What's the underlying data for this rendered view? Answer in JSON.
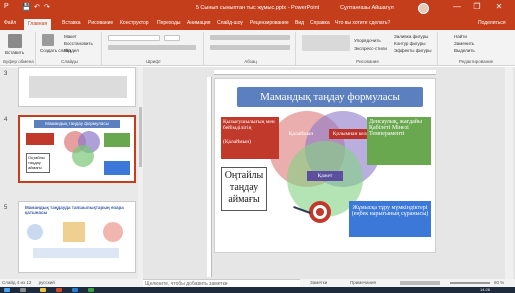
{
  "window": {
    "title": "5 Сынып сыныптан тыс жұмыс.pptx - PowerPoint",
    "user": "Сұлтанғазы Айшагүл",
    "minimize_glyph": "—",
    "restore_glyph": "❐",
    "close_glyph": "✕",
    "save_glyph": "💾",
    "undo_glyph": "↶",
    "redo_glyph": "↷"
  },
  "tabs": [
    {
      "label": "Файл"
    },
    {
      "label": "Главная"
    },
    {
      "label": "Вставка"
    },
    {
      "label": "Рисование"
    },
    {
      "label": "Конструктор"
    },
    {
      "label": "Переходы"
    },
    {
      "label": "Анимация"
    },
    {
      "label": "Слайд-шоу"
    },
    {
      "label": "Рецензирование"
    },
    {
      "label": "Вид"
    },
    {
      "label": "Справка"
    },
    {
      "label": "Что вы хотите сделать?"
    },
    {
      "label": "Поделиться"
    }
  ],
  "ribbon": {
    "clipboard": {
      "paste": "Вставить",
      "label": "Буфер обмена"
    },
    "slides": {
      "new_slide": "Создать слайд",
      "layout": "Макет",
      "reset": "Восстановить",
      "section": "Раздел",
      "label": "Слайды"
    },
    "font": {
      "label": "Шрифт"
    },
    "paragraph": {
      "label": "Абзац"
    },
    "drawing": {
      "arrange": "Упорядочить",
      "styles": "Экспресс-стили",
      "fill": "Заливка фигуры",
      "outline": "Контур фигуры",
      "effects": "Эффекты фигуры",
      "label": "Рисование"
    },
    "editing": {
      "find": "Найти",
      "replace": "Заменить",
      "select": "Выделить",
      "label": "Редактирование"
    }
  },
  "thumbnails": [
    {
      "num": "3"
    },
    {
      "num": "4",
      "title": "Мамандық таңдау формуласы",
      "sub": "Оңтайлы таңдау аймағы"
    },
    {
      "num": "5",
      "title": "Мамандық таңдауда тапшылықтарың өзара қатынасы"
    }
  ],
  "slide": {
    "title": "Мамандық таңдау формуласы",
    "box_left_top": "Қызығушылығың мен бейімділігің",
    "box_left_sub": "(Қалаймын)",
    "label_want": "Қалаймын",
    "label_can": "Қолымнан келеді",
    "box_right": "Денсаулық, жағдайы Қабілеті Мінезі Темпераменті",
    "label_need": "Қажет",
    "box_optimal": "Оңтайлы таңдау аймағы",
    "box_market": "Жұмысқа тұру мүмкіндіктері (еңбек нарығының сұранысы)"
  },
  "notes": {
    "placeholder": "Щелкните, чтобы добавить заметки"
  },
  "status": {
    "slide_of": "Слайд 4 из 12",
    "language": "русский",
    "notes_btn": "Заметки",
    "comments_btn": "Примечания",
    "zoom": "60 %"
  },
  "taskbar": {
    "time": "14:26",
    "date": "05.03.2021"
  },
  "colors": {
    "accent": "#c43e1c",
    "slide_title_bg": "#5b7fbf",
    "left_box": "#c0392b",
    "right_box": "#6aa84f",
    "market_box": "#3c78d8"
  }
}
